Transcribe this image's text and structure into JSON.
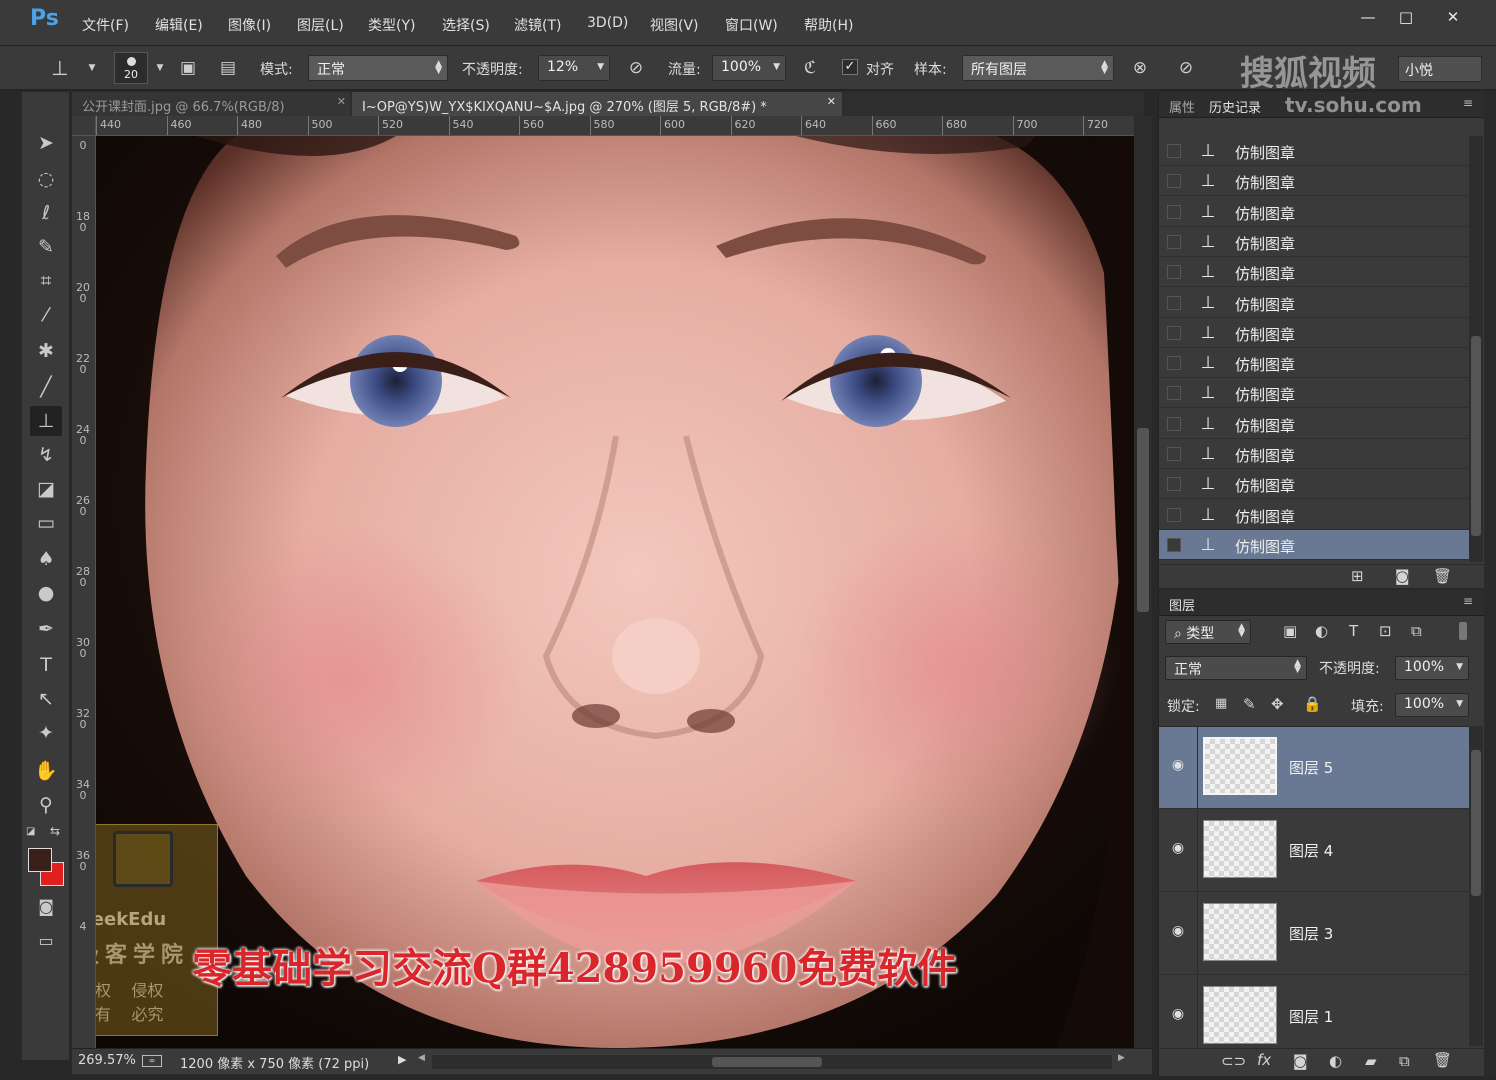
{
  "app": {
    "logo": "Ps",
    "accent": "#4aa3e8"
  },
  "menu": [
    "文件(F)",
    "编辑(E)",
    "图像(I)",
    "图层(L)",
    "类型(Y)",
    "选择(S)",
    "滤镜(T)",
    "3D(D)",
    "视图(V)",
    "窗口(W)",
    "帮助(H)"
  ],
  "window_controls": {
    "minimize": "—",
    "restore": "□",
    "close": "✕"
  },
  "options": {
    "brush_size": "20",
    "mode_label": "模式:",
    "mode_value": "正常",
    "opacity_label": "不透明度:",
    "opacity_value": "12%",
    "flow_label": "流量:",
    "flow_value": "100%",
    "aligned_label": "对齐",
    "aligned_checked": true,
    "sample_label": "样本:",
    "sample_value": "所有图层"
  },
  "watermark": {
    "site": "搜狐视频",
    "url": "tv.sohu.com",
    "user": "小悦"
  },
  "tabs": [
    {
      "label": "公开课封面.jpg @ 66.7%(RGB/8)",
      "active": false
    },
    {
      "label": "I~OP@YS)W_YX$KIXQANU~$A.jpg @ 270% (图层 5, RGB/8#) *",
      "active": true
    }
  ],
  "ruler_top": [
    "440",
    "460",
    "480",
    "500",
    "520",
    "540",
    "560",
    "580",
    "600",
    "620",
    "640",
    "660",
    "680",
    "700",
    "720"
  ],
  "ruler_left": [
    "0",
    "180",
    "200",
    "220",
    "240",
    "260",
    "280",
    "300",
    "320",
    "340",
    "360",
    "4"
  ],
  "overlay": {
    "subtitle": "零基础学习交流Q群428959960免费软件",
    "stamp_brand": "GeekEdu",
    "stamp_name": "极客学院",
    "stamp_line1": "版权    侵权",
    "stamp_line2": "所有    必究"
  },
  "status": {
    "zoom": "269.57%",
    "doc_info": "1200 像素 x 750 像素 (72 ppi)"
  },
  "history_panel": {
    "tabs": [
      "属性",
      "历史记录"
    ],
    "items": [
      "仿制图章",
      "仿制图章",
      "仿制图章",
      "仿制图章",
      "仿制图章",
      "仿制图章",
      "仿制图章",
      "仿制图章",
      "仿制图章",
      "仿制图章",
      "仿制图章",
      "仿制图章",
      "仿制图章",
      "仿制图章"
    ],
    "selected_index": 13
  },
  "layers_panel": {
    "title": "图层",
    "filter_label": "类型",
    "blend_mode": "正常",
    "opacity_label": "不透明度:",
    "opacity_value": "100%",
    "lock_label": "锁定:",
    "fill_label": "填充:",
    "fill_value": "100%",
    "layers": [
      {
        "name": "图层 5",
        "selected": true
      },
      {
        "name": "图层 4",
        "selected": false
      },
      {
        "name": "图层 3",
        "selected": false
      },
      {
        "name": "图层 1",
        "selected": false
      }
    ]
  },
  "colors": {
    "foreground": "#3a201a",
    "background": "#e02020",
    "selection": "#6a7993"
  }
}
